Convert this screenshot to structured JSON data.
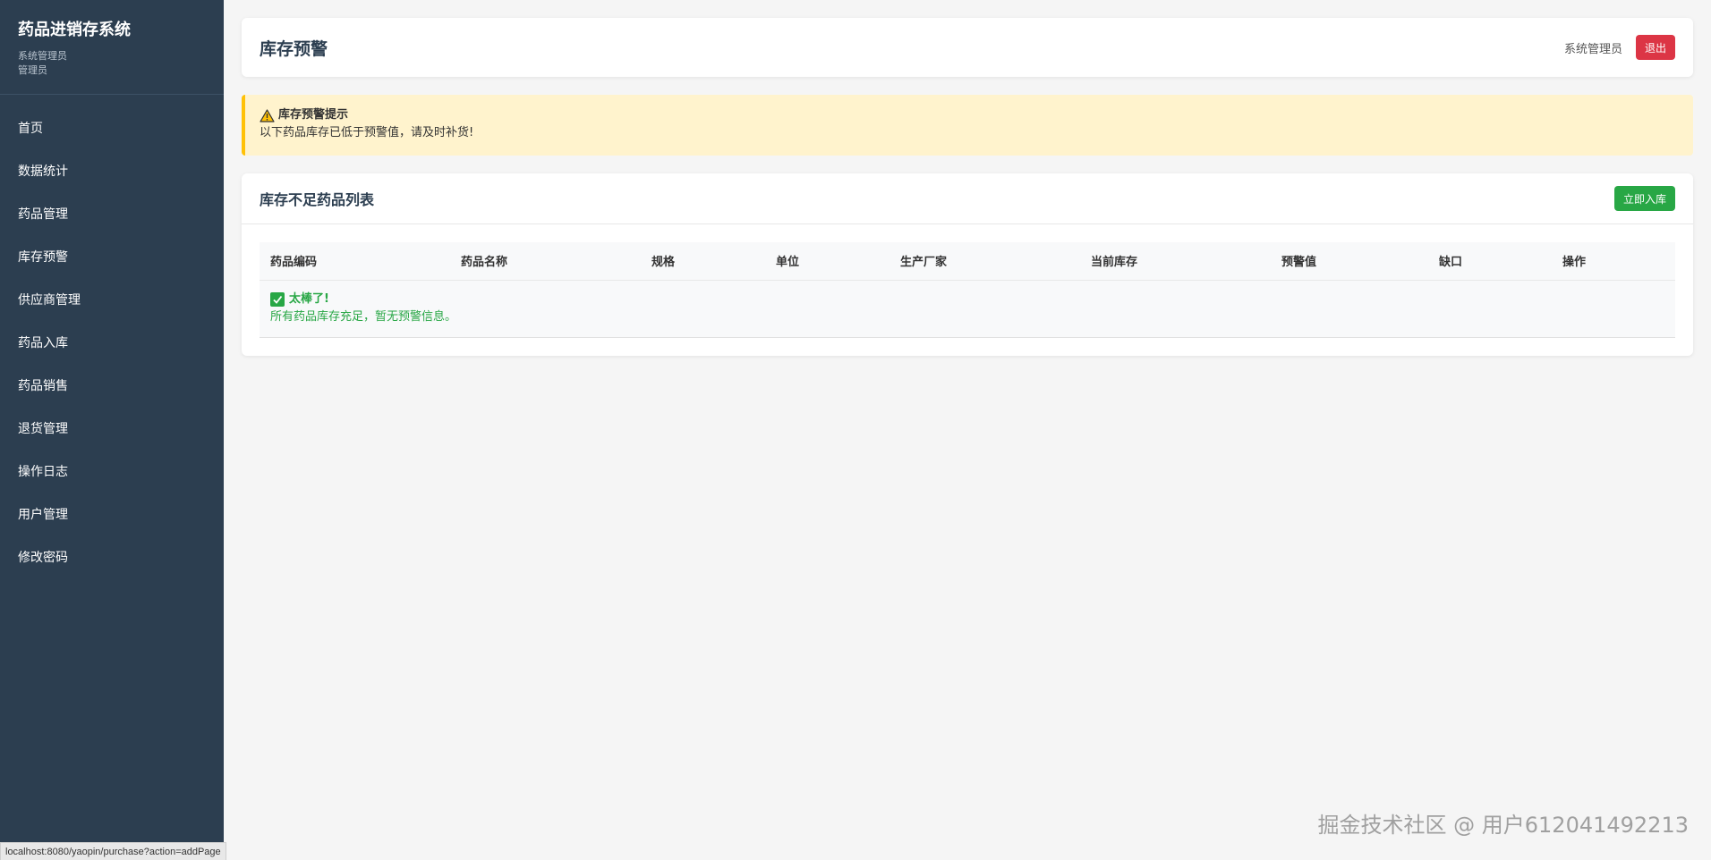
{
  "sidebar": {
    "title": "药品进销存系统",
    "user_name": "系统管理员",
    "user_role": "管理员",
    "items": [
      {
        "label": "首页"
      },
      {
        "label": "数据统计"
      },
      {
        "label": "药品管理"
      },
      {
        "label": "库存预警"
      },
      {
        "label": "供应商管理"
      },
      {
        "label": "药品入库"
      },
      {
        "label": "药品销售"
      },
      {
        "label": "退货管理"
      },
      {
        "label": "操作日志"
      },
      {
        "label": "用户管理"
      },
      {
        "label": "修改密码"
      }
    ]
  },
  "header": {
    "title": "库存预警",
    "user": "系统管理员",
    "logout_label": "退出"
  },
  "alert": {
    "icon": "warning-icon",
    "title": "库存预警提示",
    "message": "以下药品库存已低于预警值，请及时补货!"
  },
  "list": {
    "title": "库存不足药品列表",
    "stock_in_label": "立即入库",
    "columns": [
      "药品编码",
      "药品名称",
      "规格",
      "单位",
      "生产厂家",
      "当前库存",
      "预警值",
      "缺口",
      "操作"
    ],
    "empty": {
      "icon": "check-icon",
      "title": "太棒了!",
      "message": "所有药品库存充足，暂无预警信息。"
    }
  },
  "status_url": "localhost:8080/yaopin/purchase?action=addPage",
  "watermark": "掘金技术社区 @ 用户612041492213",
  "colors": {
    "sidebar_bg": "#2c3e50",
    "danger": "#dc3545",
    "success": "#28a745",
    "warning_bg": "#fff3cd",
    "warning_border": "#ffc107"
  }
}
